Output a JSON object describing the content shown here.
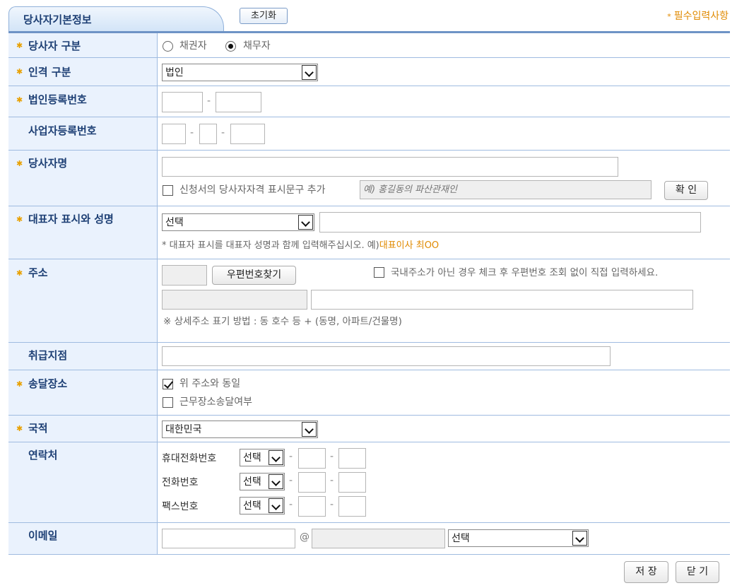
{
  "header": {
    "title": "당사자기본정보",
    "reset_label": "초기화",
    "required_note": "필수입력사항",
    "required_star": "*"
  },
  "fields": {
    "party_type": {
      "label": "당사자 구분",
      "options": [
        "채권자",
        "채무자"
      ],
      "selected": "채무자"
    },
    "person_type": {
      "label": "인격 구분",
      "selected": "법인"
    },
    "corp_reg_no": {
      "label": "법인등록번호",
      "dash": "-"
    },
    "biz_reg_no": {
      "label": "사업자등록번호",
      "dash": "-"
    },
    "party_name": {
      "label": "당사자명",
      "add_phrase_label": "신청서의 당사자자격 표시문구 추가",
      "phrase_placeholder": "예) 홍길동의 파산관재인",
      "confirm_label": "확 인"
    },
    "representative": {
      "label": "대표자 표시와 성명",
      "selected": "선택",
      "note_prefix": "* 대표자 표시를 대표자 성명과 함께 입력해주십시오. 예)",
      "note_example": "대표이사 최OO"
    },
    "address": {
      "label": "주소",
      "zip_button": "우편번호찾기",
      "foreign_label": "국내주소가 아닌 경우 체크 후 우편번호 조회 없이 직접 입력하세요.",
      "detail_note": "※ 상세주소 표기 방법 : 동 호수 등 + (동명, 아파트/건물명)"
    },
    "branch": {
      "label": "취급지점"
    },
    "delivery": {
      "label": "송달장소",
      "same_address_label": "위 주소와 동일",
      "same_address_checked": true,
      "workplace_label": "근무장소송달여부",
      "workplace_checked": false
    },
    "nationality": {
      "label": "국적",
      "selected": "대한민국"
    },
    "contact": {
      "label": "연락처",
      "rows": [
        {
          "label": "휴대전화번호",
          "selected": "선택"
        },
        {
          "label": "전화번호",
          "selected": "선택"
        },
        {
          "label": "팩스번호",
          "selected": "선택"
        }
      ],
      "dash": "-"
    },
    "email": {
      "label": "이메일",
      "at": "@",
      "selected": "선택"
    }
  },
  "footer": {
    "save_label": "저 장",
    "close_label": "닫 기"
  },
  "colors": {
    "label_bg": "#eaf2fd",
    "label_text": "#1d3f74",
    "accent_orange": "#e08a00",
    "border_blue": "#9fbbe0"
  }
}
